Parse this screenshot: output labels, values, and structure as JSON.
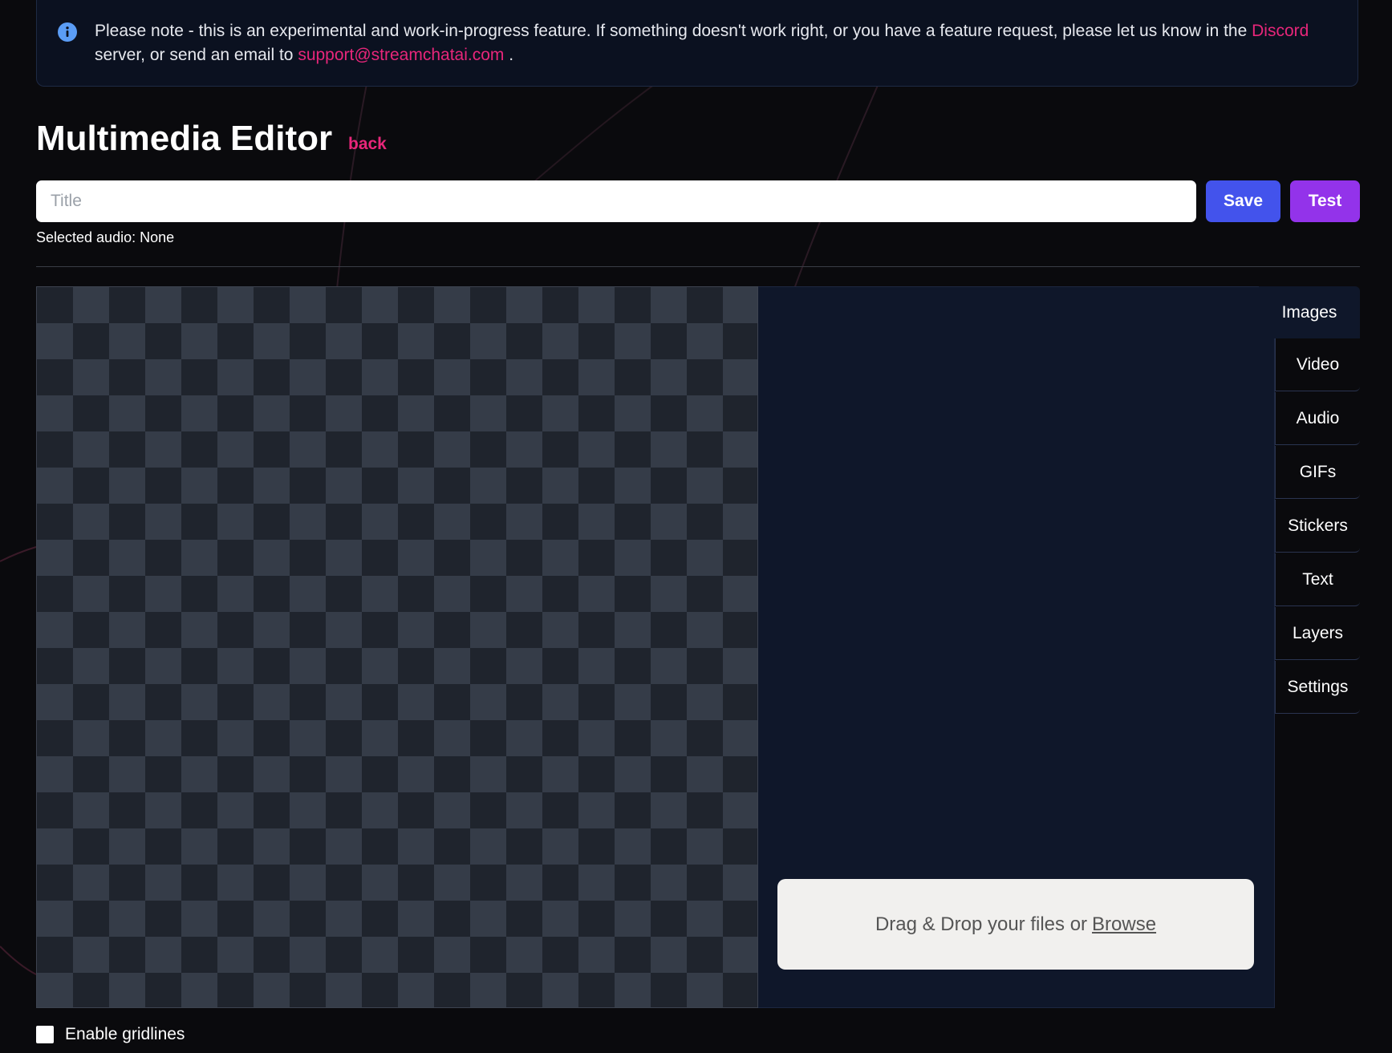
{
  "notice": {
    "text_before": "Please note - this is an experimental and work-in-progress feature. If something doesn't work right, or you have a feature request, please let us know in the",
    "discord_link": "Discord",
    "text_middle": "server, or send an email to",
    "email_link": "support@streamchatai.com",
    "text_after": ".",
    "icon": "info-icon"
  },
  "header": {
    "title": "Multimedia Editor",
    "back_label": "back"
  },
  "title_input": {
    "placeholder": "Title",
    "value": ""
  },
  "toolbar": {
    "save_label": "Save",
    "test_label": "Test"
  },
  "audio": {
    "selected_text": "Selected audio: None"
  },
  "tabs": {
    "active": "Images",
    "items": [
      "Video",
      "Audio",
      "GIFs",
      "Stickers",
      "Text",
      "Layers",
      "Settings"
    ]
  },
  "dropzone": {
    "text": "Drag & Drop your files or",
    "browse_label": "Browse"
  },
  "gridlines": {
    "label": "Enable gridlines",
    "checked": false
  },
  "colors": {
    "accent_pink": "#e8267a",
    "save_blue": "#4353ec",
    "test_purple": "#9333ea",
    "panel_navy": "#0f172a"
  }
}
